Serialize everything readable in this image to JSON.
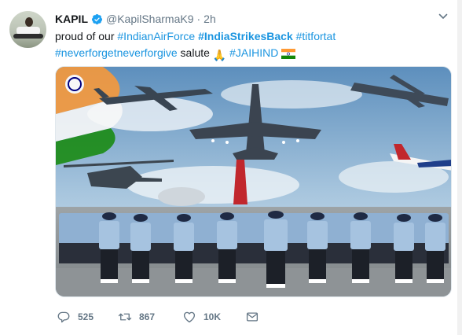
{
  "user": {
    "display_name": "KAPIL",
    "handle": "@KapilSharmaK9",
    "separator": "·",
    "timestamp": "2h",
    "verified": true
  },
  "tweet": {
    "line1": {
      "plain1": "proud of our ",
      "tag1": "#IndianAirForce",
      "tag2": "#IndiaStrikesBack",
      "tag3": "#titfortat"
    },
    "line2": {
      "tag1": "#neverforgetneverforgive",
      "plain1": " salute ",
      "emoji": "🙏",
      "tag2": "#JAIHIND",
      "flag": "india-flag-icon"
    }
  },
  "actions": {
    "replies": "525",
    "retweets": "867",
    "likes": "10K"
  },
  "colors": {
    "link": "#1b95e0",
    "muted": "#657786",
    "verified": "#1da1f2"
  }
}
